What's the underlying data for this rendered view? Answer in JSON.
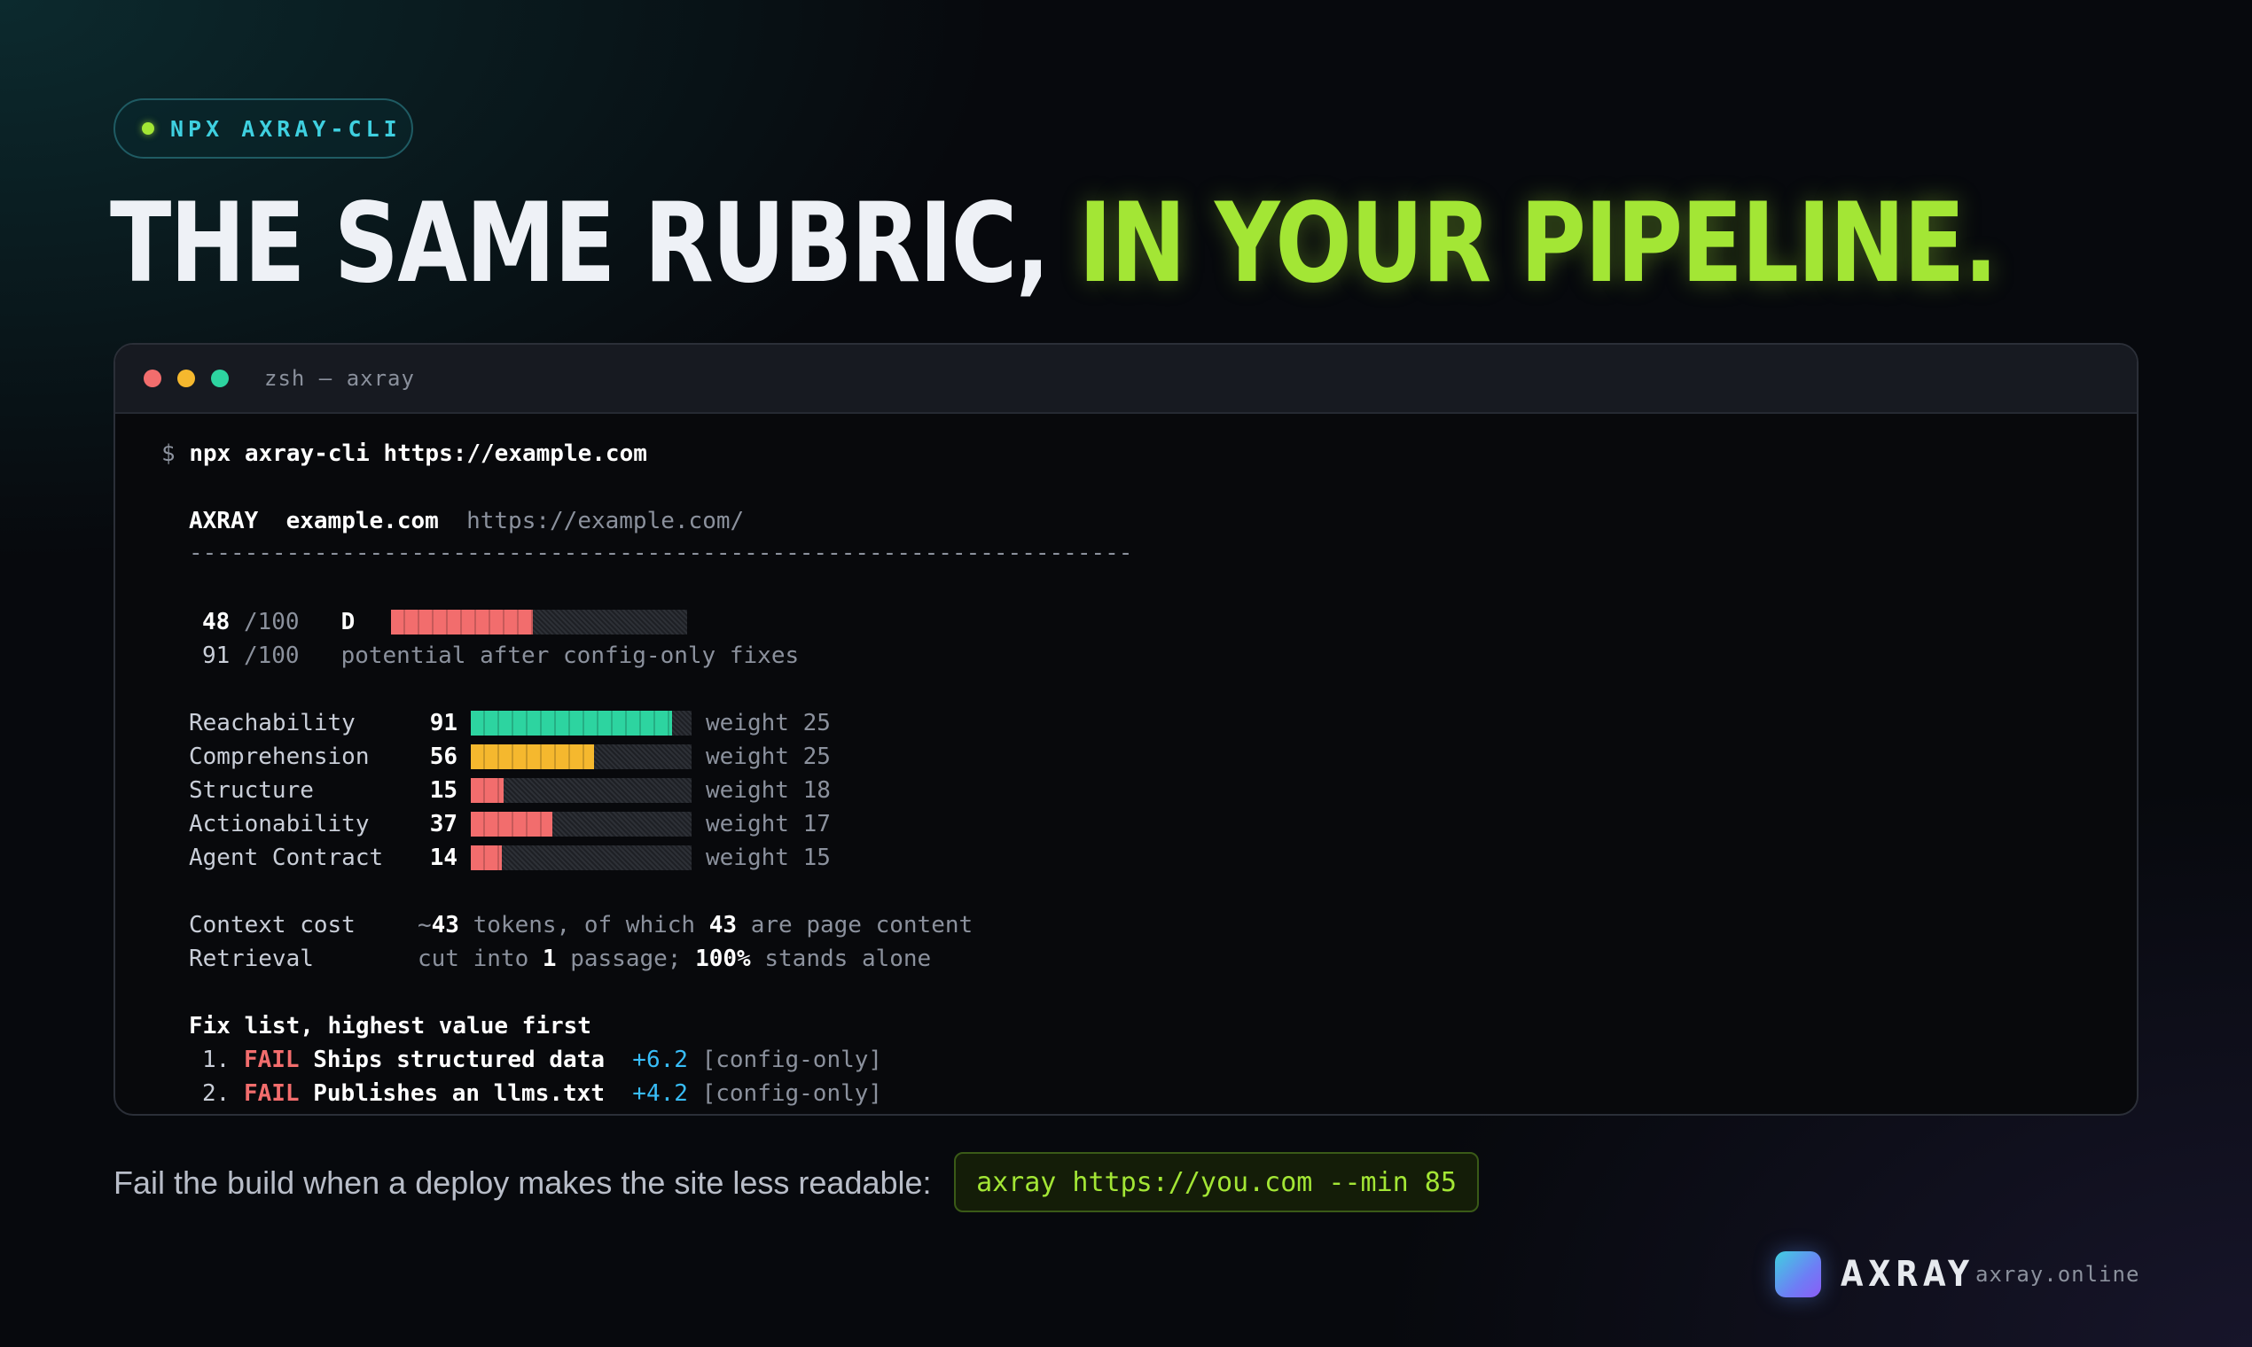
{
  "badge": {
    "label": "NPX AXRAY-CLI"
  },
  "headline": {
    "white": "THE SAME RUBRIC,",
    "green": "IN YOUR PIPELINE."
  },
  "terminal": {
    "title": "zsh — axray",
    "prompt": "$",
    "command": "npx axray-cli https://example.com",
    "report_brand": "AXRAY",
    "report_domain": "example.com",
    "report_url": "https://example.com/",
    "divider": "--------------------------------------------------------------------",
    "score": {
      "value": "48",
      "max": "/100",
      "grade": "D",
      "fraction": 0.48
    },
    "potential": {
      "value": "91",
      "max": "/100",
      "text": "potential after config-only fixes"
    },
    "categories": [
      {
        "name": "Reachability",
        "score": "91",
        "fraction": 0.91,
        "weight": "weight 25",
        "color": "#2dd4a0"
      },
      {
        "name": "Comprehension",
        "score": "56",
        "fraction": 0.56,
        "weight": "weight 25",
        "color": "#f5b82e"
      },
      {
        "name": "Structure",
        "score": "15",
        "fraction": 0.15,
        "weight": "weight 18",
        "color": "#f26d6d"
      },
      {
        "name": "Actionability",
        "score": "37",
        "fraction": 0.37,
        "weight": "weight 17",
        "color": "#f26d6d"
      },
      {
        "name": "Agent Contract",
        "score": "14",
        "fraction": 0.14,
        "weight": "weight 15",
        "color": "#f26d6d"
      }
    ],
    "context": {
      "label": "Context cost",
      "prefix": "~",
      "tokens": "43",
      "mid": " tokens, of which ",
      "content": "43",
      "suffix": " are page content"
    },
    "retrieval": {
      "label": "Retrieval",
      "prefix": "cut into ",
      "count": "1",
      "mid": " passage; ",
      "pct": "100%",
      "suffix": " stands alone"
    },
    "fix_title": "Fix list, highest value first",
    "fixes": [
      {
        "num": "1.",
        "status": "FAIL",
        "name": "Ships structured data",
        "delta": "+6.2",
        "tag": "[config-only]"
      },
      {
        "num": "2.",
        "status": "FAIL",
        "name": "Publishes an llms.txt",
        "delta": "+4.2",
        "tag": "[config-only]"
      }
    ]
  },
  "footer": {
    "text": "Fail the build when a deploy makes the site less readable:",
    "command": "axray https://you.com --min 85"
  },
  "brand": {
    "name": "AXRAY",
    "url": "axray.online"
  },
  "colors": {
    "accent_green": "#a3e635",
    "accent_cyan": "#3fd0e0",
    "fail_red": "#f26d6d"
  }
}
